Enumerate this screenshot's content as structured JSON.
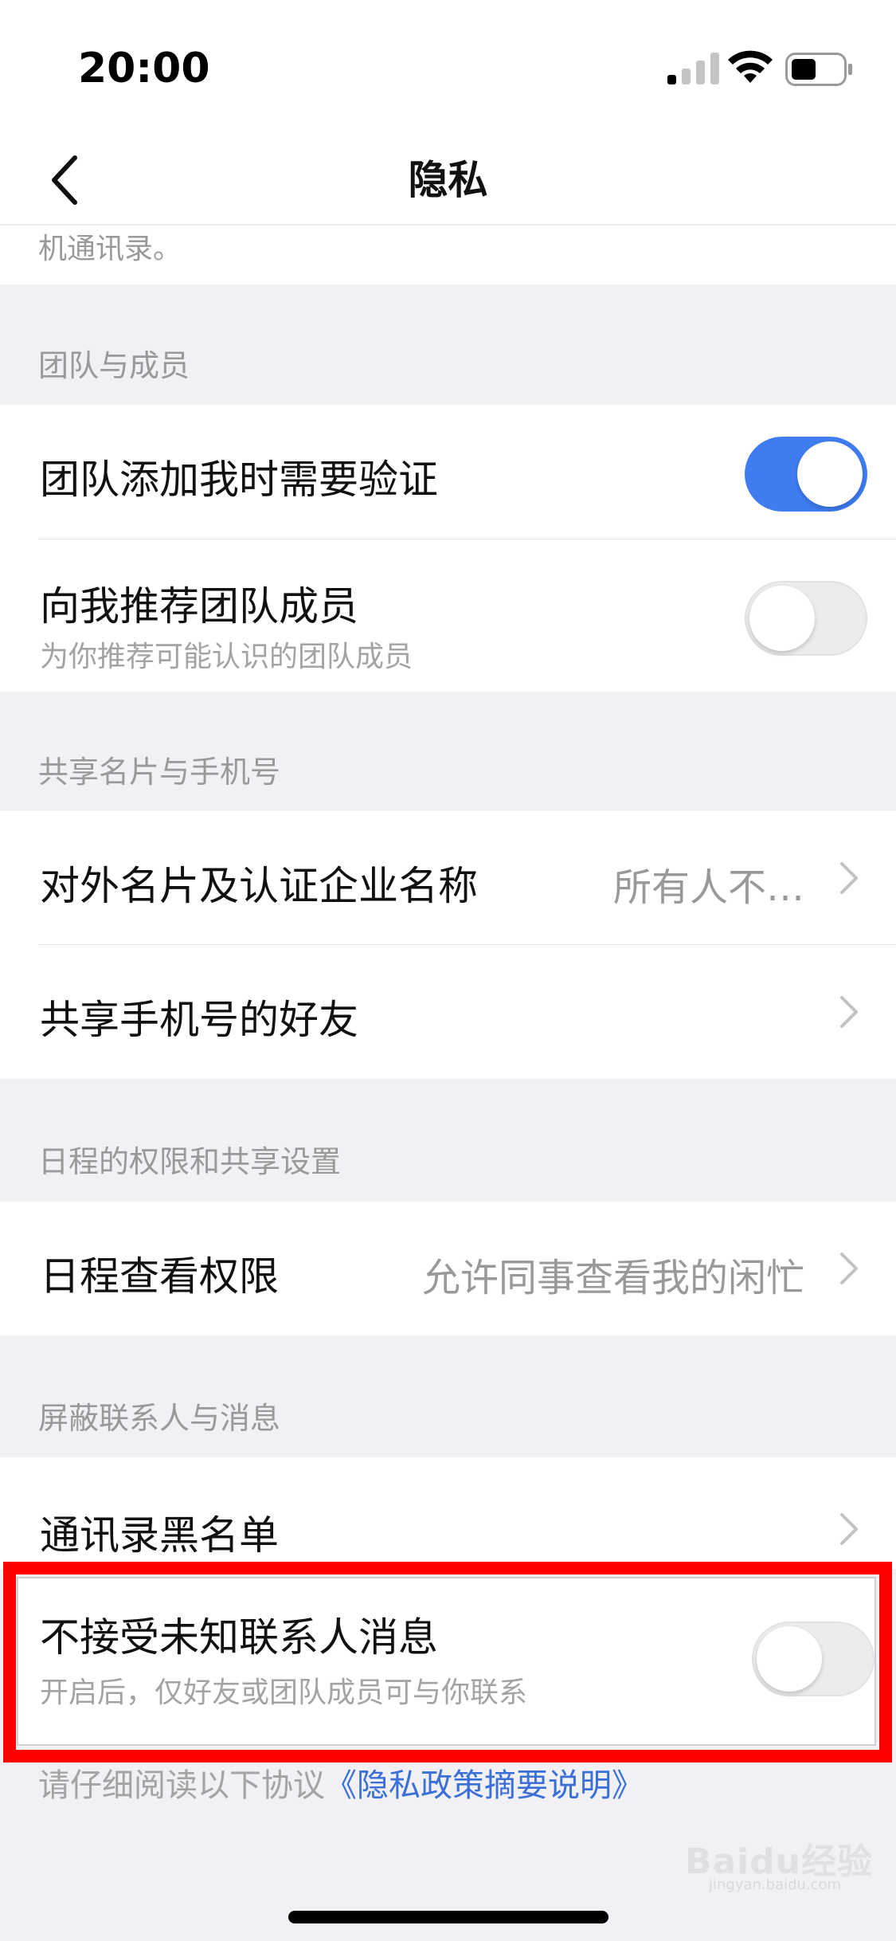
{
  "status_bar": {
    "time": "20:00",
    "icons": [
      "signal-icon",
      "wifi-icon",
      "battery-icon"
    ]
  },
  "nav": {
    "title": "隐私",
    "back_icon": "chevron-left-icon"
  },
  "top_remnant": "机通讯录。",
  "sections": {
    "team": {
      "header": "团队与成员",
      "rows": [
        {
          "title": "团队添加我时需要验证",
          "switch": true
        },
        {
          "title": "向我推荐团队成员",
          "subtitle": "为你推荐可能认识的团队成员",
          "switch": false
        }
      ]
    },
    "share": {
      "header": "共享名片与手机号",
      "rows": [
        {
          "title": "对外名片及认证企业名称",
          "value": "所有人不…"
        },
        {
          "title": "共享手机号的好友"
        }
      ]
    },
    "schedule": {
      "header": "日程的权限和共享设置",
      "rows": [
        {
          "title": "日程查看权限",
          "value": "允许同事查看我的闲忙"
        }
      ]
    },
    "block": {
      "header": "屏蔽联系人与消息",
      "rows": [
        {
          "title": "通讯录黑名单"
        },
        {
          "title": "不接受未知联系人消息",
          "subtitle": "开启后，仅好友或团队成员可与你联系",
          "switch": false
        }
      ]
    }
  },
  "footer": {
    "text": "请仔细阅读以下协议",
    "link": "《隐私政策摘要说明》"
  },
  "watermark": {
    "main": "Baidu经验",
    "sub": "jingyan.baidu.com"
  },
  "colors": {
    "accent": "#3e7cf0",
    "highlight": "#ff0000",
    "link": "#3a6fd8"
  }
}
